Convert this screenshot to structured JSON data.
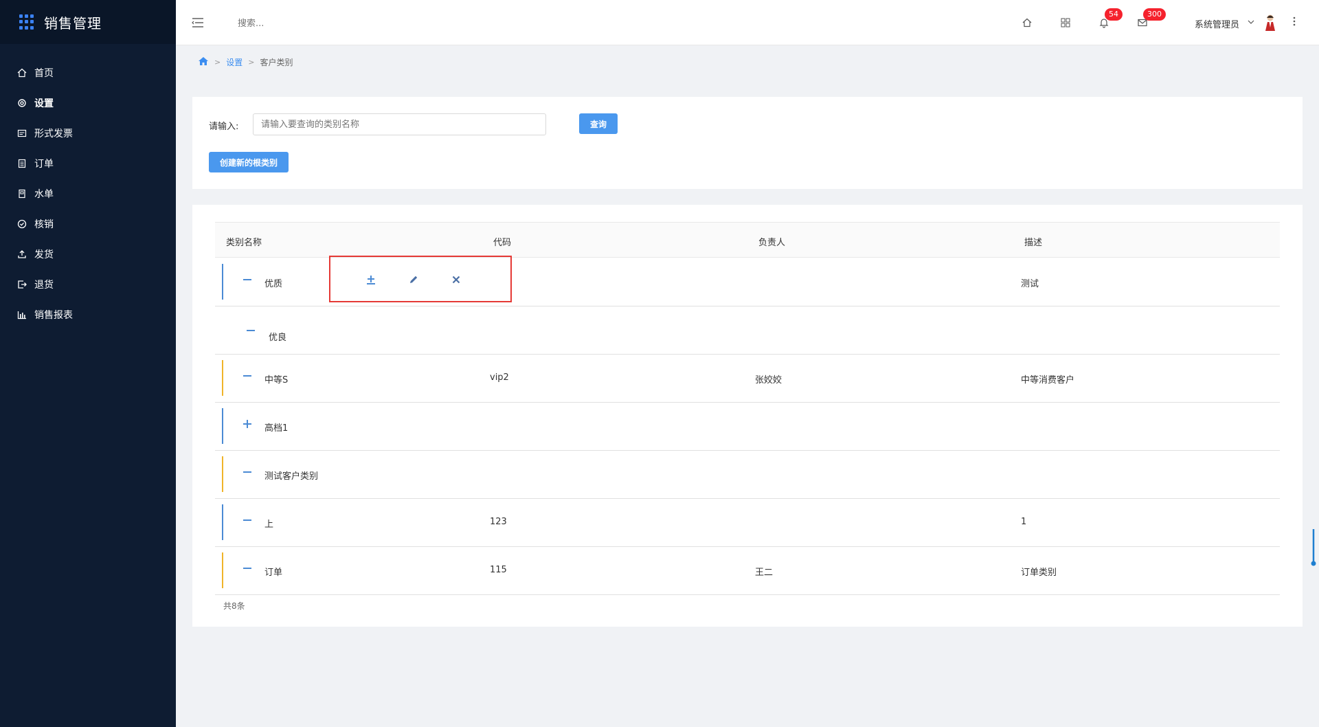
{
  "app": {
    "title": "销售管理"
  },
  "sidebar": {
    "items": [
      {
        "label": "首页",
        "icon": "home-icon"
      },
      {
        "label": "设置",
        "icon": "gear-icon",
        "active": true
      },
      {
        "label": "形式发票",
        "icon": "invoice-icon"
      },
      {
        "label": "订单",
        "icon": "clipboard-icon"
      },
      {
        "label": "水单",
        "icon": "receipt-icon"
      },
      {
        "label": "核销",
        "icon": "check-circle-icon"
      },
      {
        "label": "发货",
        "icon": "upload-icon"
      },
      {
        "label": "退货",
        "icon": "return-icon"
      },
      {
        "label": "销售报表",
        "icon": "bar-chart-icon"
      }
    ]
  },
  "header": {
    "search_placeholder": "搜索...",
    "notifications_count": "54",
    "messages_count": "300",
    "user_name": "系统管理员"
  },
  "breadcrumb": {
    "item1": "设置",
    "item2": "客户类别"
  },
  "search": {
    "label": "请输入:",
    "placeholder": "请输入要查询的类别名称",
    "query_button": "查询",
    "create_button": "创建新的根类别"
  },
  "table": {
    "headers": {
      "name": "类别名称",
      "code": "代码",
      "owner": "负责人",
      "desc": "描述"
    },
    "rows": [
      {
        "toggle": "−",
        "name": "优质",
        "code": "",
        "owner": "",
        "desc": "测试",
        "color": "#4a8ad4"
      },
      {
        "toggle": "−",
        "name": "优良",
        "code": "",
        "owner": "",
        "desc": "",
        "color": ""
      },
      {
        "toggle": "−",
        "name": "中等S",
        "code": "vip2",
        "owner": "张姣姣",
        "desc": "中等消费客户",
        "color": "#f0b429"
      },
      {
        "toggle": "+",
        "name": "高档1",
        "code": "",
        "owner": "",
        "desc": "",
        "color": "#4a8ad4"
      },
      {
        "toggle": "−",
        "name": "测试客户类别",
        "code": "",
        "owner": "",
        "desc": "",
        "color": "#f0b429"
      },
      {
        "toggle": "−",
        "name": "上",
        "code": "123",
        "owner": "",
        "desc": "1",
        "color": "#4a8ad4"
      },
      {
        "toggle": "−",
        "name": "订单",
        "code": "115",
        "owner": "王二",
        "desc": "订单类别",
        "color": "#f0b429"
      }
    ],
    "total": "共8条"
  }
}
